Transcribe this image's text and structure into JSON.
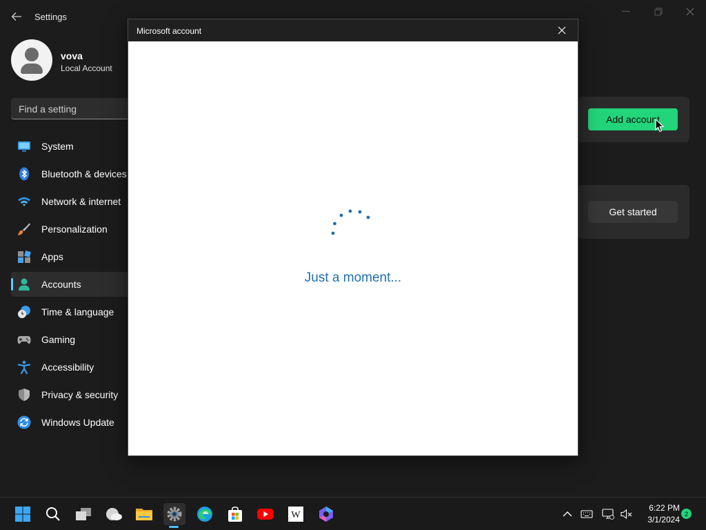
{
  "window": {
    "title": "Settings"
  },
  "profile": {
    "name": "vova",
    "account_type": "Local Account"
  },
  "search": {
    "placeholder": "Find a setting"
  },
  "sidebar": {
    "items": [
      {
        "label": "System",
        "icon": "system-icon"
      },
      {
        "label": "Bluetooth & devices",
        "icon": "bluetooth-icon"
      },
      {
        "label": "Network & internet",
        "icon": "wifi-icon"
      },
      {
        "label": "Personalization",
        "icon": "brush-icon"
      },
      {
        "label": "Apps",
        "icon": "apps-icon"
      },
      {
        "label": "Accounts",
        "icon": "accounts-icon",
        "active": true
      },
      {
        "label": "Time & language",
        "icon": "clock-globe-icon"
      },
      {
        "label": "Gaming",
        "icon": "gamepad-icon"
      },
      {
        "label": "Accessibility",
        "icon": "accessibility-icon"
      },
      {
        "label": "Privacy & security",
        "icon": "shield-icon"
      },
      {
        "label": "Windows Update",
        "icon": "update-icon"
      }
    ]
  },
  "main": {
    "add_account_label": "Add account",
    "get_started_label": "Get started"
  },
  "dialog": {
    "title": "Microsoft account",
    "loading_text": "Just a moment..."
  },
  "taskbar": {
    "apps": [
      {
        "name": "start-icon"
      },
      {
        "name": "search-icon"
      },
      {
        "name": "task-view-icon"
      },
      {
        "name": "weather-icon"
      },
      {
        "name": "file-explorer-icon"
      },
      {
        "name": "settings-icon",
        "active": true
      },
      {
        "name": "edge-icon"
      },
      {
        "name": "store-icon"
      },
      {
        "name": "youtube-icon"
      },
      {
        "name": "wikipedia-icon"
      },
      {
        "name": "copilot-icon"
      }
    ],
    "wiki_glyph": "W",
    "clock": {
      "time": "6:22 PM",
      "date": "3/1/2024"
    },
    "notification_count": "2"
  },
  "colors": {
    "accent": "#60cdff",
    "button_green": "#22d47a",
    "loading_text": "#1f6fb2",
    "background": "#1c1c1c"
  }
}
